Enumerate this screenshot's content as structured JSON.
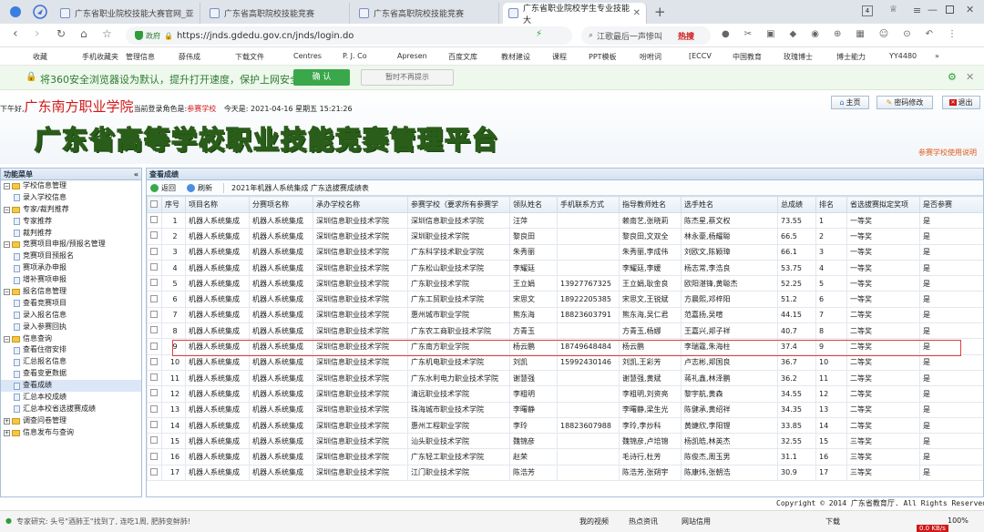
{
  "browser": {
    "tabs": [
      {
        "label": "广东省职业院校技能大赛官网_亚"
      },
      {
        "label": "广东省高职院校技能竞赛"
      },
      {
        "label": "广东省高职院校技能竞赛"
      },
      {
        "label": "广东省职业院校学生专业技能大"
      }
    ],
    "gov_label": "政府",
    "url": "https://jnds.gdedu.gov.cn/jnds/login.do",
    "search_text": "江歌最后一声惨叫",
    "hot_label": "热搜",
    "bookmarks": [
      "收藏",
      "手机收藏夹",
      "管理信息",
      "薛伟成",
      "下载文件",
      "Centres",
      "P. J. Co",
      "Apresen",
      "百度文库",
      "教材建设",
      "课程",
      "PPT模板",
      "吩咐词",
      "[ECCV",
      "中国教育",
      "玫瑰博士",
      "博士能力",
      "YY4480"
    ]
  },
  "notice": {
    "text": "将360安全浏览器设为默认，提升打开速度，保护上网安全",
    "confirm": "确 认",
    "dismiss": "暂时不再提示"
  },
  "header": {
    "greeting": "下午好,",
    "school": "广东南方职业学院",
    "role_prefix": "当前登录角色是:",
    "role": "参赛学校",
    "date": "今天是: 2021-04-16 星期五 15:21:26",
    "title": "广东省高等学校职业技能竞赛管理平台",
    "btn_home": "主页",
    "btn_password": "密码修改",
    "btn_logout": "退出",
    "help_link": "参赛学校使用说明"
  },
  "sidebar": {
    "title": "功能菜单",
    "nodes": [
      {
        "label": "学校信息管理",
        "level": 0,
        "type": "folder"
      },
      {
        "label": "录入学校信息",
        "level": 1,
        "type": "page"
      },
      {
        "label": "专家/裁判推荐",
        "level": 0,
        "type": "folder"
      },
      {
        "label": "专家推荐",
        "level": 1,
        "type": "page"
      },
      {
        "label": "裁判推荐",
        "level": 1,
        "type": "page"
      },
      {
        "label": "竞赛项目申报/预报名管理",
        "level": 0,
        "type": "folder"
      },
      {
        "label": "竞赛项目预报名",
        "level": 1,
        "type": "page"
      },
      {
        "label": "赛项承办申报",
        "level": 1,
        "type": "page"
      },
      {
        "label": "增补赛项申报",
        "level": 1,
        "type": "page"
      },
      {
        "label": "报名信息管理",
        "level": 0,
        "type": "folder"
      },
      {
        "label": "查看竞赛项目",
        "level": 1,
        "type": "page"
      },
      {
        "label": "录入报名信息",
        "level": 1,
        "type": "page"
      },
      {
        "label": "录入参赛回执",
        "level": 1,
        "type": "page"
      },
      {
        "label": "信息查询",
        "level": 0,
        "type": "folder"
      },
      {
        "label": "查看住宿安排",
        "level": 1,
        "type": "page"
      },
      {
        "label": "汇总报名信息",
        "level": 1,
        "type": "page"
      },
      {
        "label": "查看变更数据",
        "level": 1,
        "type": "page"
      },
      {
        "label": "查看成绩",
        "level": 1,
        "type": "page",
        "selected": true
      },
      {
        "label": "汇总本校成绩",
        "level": 1,
        "type": "page"
      },
      {
        "label": "汇总本校省选拔赛成绩",
        "level": 1,
        "type": "page"
      },
      {
        "label": "调查问卷管理",
        "level": 0,
        "type": "folder",
        "collapsed": true
      },
      {
        "label": "信息发布与查询",
        "level": 0,
        "type": "folder",
        "collapsed": true
      }
    ]
  },
  "main": {
    "title": "查看成绩",
    "back": "返回",
    "refresh": "刷新",
    "caption": "2021年机器人系统集成 广东选拔赛成绩表",
    "columns": [
      "序号",
      "项目名称",
      "分赛项名称",
      "承办学校名称",
      "参赛学校（要求所有参赛学",
      "领队姓名",
      "手机联系方式",
      "指导教师姓名",
      "选手姓名",
      "总成绩",
      "排名",
      "省选拔赛拟定奖项",
      "是否参赛"
    ],
    "rows": [
      [
        "1",
        "机器人系统集成",
        "机器人系统集成",
        "深圳信息职业技术学院",
        "深圳信息职业技术学院",
        "汪萍",
        "",
        "赖南艺,张晓莉",
        "陈杰星,蔡文权",
        "73.55",
        "1",
        "一等奖",
        "是"
      ],
      [
        "2",
        "机器人系统集成",
        "机器人系统集成",
        "深圳信息职业技术学院",
        "深圳职业技术学院",
        "黎良田",
        "",
        "黎良田,文双全",
        "林永豪,杨耀聪",
        "66.5",
        "2",
        "一等奖",
        "是"
      ],
      [
        "3",
        "机器人系统集成",
        "机器人系统集成",
        "深圳信息职业技术学院",
        "广东科学技术职业学院",
        "朱秀丽",
        "",
        "朱秀丽,李成伟",
        "刘欧文,陈颖璋",
        "66.1",
        "3",
        "一等奖",
        "是"
      ],
      [
        "4",
        "机器人系统集成",
        "机器人系统集成",
        "深圳信息职业技术学院",
        "广东松山职业技术学院",
        "李耀廷",
        "",
        "李耀廷,李媛",
        "杨志常,李浩良",
        "53.75",
        "4",
        "一等奖",
        "是"
      ],
      [
        "5",
        "机器人系统集成",
        "机器人系统集成",
        "深圳信息职业技术学院",
        "广东职业技术学院",
        "王立娟",
        "13927767325",
        "王立娟,耿金良",
        "欧阳湛锋,黄聪杰",
        "52.25",
        "5",
        "一等奖",
        "是"
      ],
      [
        "6",
        "机器人系统集成",
        "机器人系统集成",
        "深圳信息职业技术学院",
        "广东工贸职业技术学院",
        "宋思文",
        "18922205385",
        "宋思文,王锐斌",
        "方晨熙,邓梓阳",
        "51.2",
        "6",
        "一等奖",
        "是"
      ],
      [
        "7",
        "机器人系统集成",
        "机器人系统集成",
        "深圳信息职业技术学院",
        "惠州城市职业学院",
        "熊东海",
        "18823603791",
        "熊东海,吴仁君",
        "范嘉扬,吴喧",
        "44.15",
        "7",
        "二等奖",
        "是"
      ],
      [
        "8",
        "机器人系统集成",
        "机器人系统集成",
        "深圳信息职业技术学院",
        "广东农工商职业技术学院",
        "方青玉",
        "",
        "方青玉,杨娜",
        "王嘉兴,郑子祥",
        "40.7",
        "8",
        "二等奖",
        "是"
      ],
      [
        "9",
        "机器人系统集成",
        "机器人系统集成",
        "深圳信息职业技术学院",
        "广东南方职业学院",
        "杨云鹏",
        "18749648484",
        "杨云鹏",
        "李瑞霆,朱海柱",
        "37.4",
        "9",
        "二等奖",
        "是"
      ],
      [
        "10",
        "机器人系统集成",
        "机器人系统集成",
        "深圳信息职业技术学院",
        "广东机电职业技术学院",
        "刘凯",
        "15992430146",
        "刘凯,王彩芳",
        "卢志彬,郑国良",
        "36.7",
        "10",
        "二等奖",
        "是"
      ],
      [
        "11",
        "机器人系统集成",
        "机器人系统集成",
        "深圳信息职业技术学院",
        "广东水利电力职业技术学院",
        "谢慧强",
        "",
        "谢慧强,黄斌",
        "蒋礼鑫,林泽鹏",
        "36.2",
        "11",
        "二等奖",
        "是"
      ],
      [
        "12",
        "机器人系统集成",
        "机器人系统集成",
        "深圳信息职业技术学院",
        "清远职业技术学院",
        "李粗明",
        "",
        "李粗明,刘资亮",
        "黎宇航,黄森",
        "34.55",
        "12",
        "二等奖",
        "是"
      ],
      [
        "13",
        "机器人系统集成",
        "机器人系统集成",
        "深圳信息职业技术学院",
        "珠海城市职业技术学院",
        "李曙静",
        "",
        "李曙静,梁生光",
        "陈健承,黄绍祥",
        "34.35",
        "13",
        "二等奖",
        "是"
      ],
      [
        "14",
        "机器人系统集成",
        "机器人系统集成",
        "深圳信息职业技术学院",
        "惠州工程职业学院",
        "李玲",
        "18823607988",
        "李玲,李炒科",
        "黄婕欣,李阳锂",
        "33.85",
        "14",
        "二等奖",
        "是"
      ],
      [
        "15",
        "机器人系统集成",
        "机器人系统集成",
        "深圳信息职业技术学院",
        "汕头职业技术学院",
        "魏锦彦",
        "",
        "魏锦彦,卢培锦",
        "杨凯皓,林英杰",
        "32.55",
        "15",
        "三等奖",
        "是"
      ],
      [
        "16",
        "机器人系统集成",
        "机器人系统集成",
        "深圳信息职业技术学院",
        "广东轻工职业技术学院",
        "赵荣",
        "",
        "毛诗行,杜芳",
        "陈俊杰,周玉男",
        "31.1",
        "16",
        "三等奖",
        "是"
      ],
      [
        "17",
        "机器人系统集成",
        "机器人系统集成",
        "深圳信息职业技术学院",
        "江门职业技术学院",
        "陈浩芳",
        "",
        "陈浩芳,张朔宇",
        "陈康炜,张朝浩",
        "30.9",
        "17",
        "三等奖",
        "是"
      ]
    ]
  },
  "footer": {
    "copyright": "Copyright © 2014 广东省教育厅. All Rights Reserved."
  },
  "statusbar": {
    "news": "专家研究: 头号\"酒肺王\"找到了, 连吃1周, 肥肺变鲜肺!",
    "video": "我的视频",
    "hot_news": "热点资讯",
    "speed": "网站信用",
    "download": "下载",
    "zoom": "100%",
    "net": "0.0 KB/s"
  },
  "colors": {
    "title_red": "#d01818",
    "highlight": "#e04040",
    "accent_green": "#2e9c3a"
  }
}
